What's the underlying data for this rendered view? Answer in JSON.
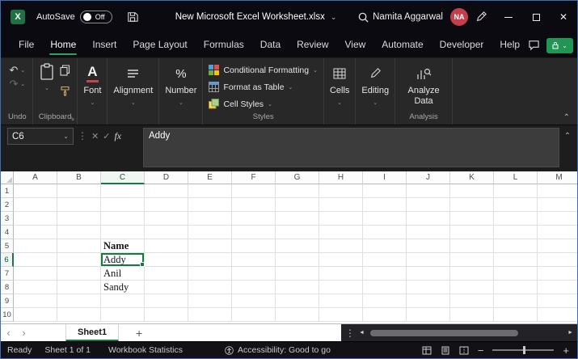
{
  "colors": {
    "accent_green": "#107C41",
    "menu_underline_green": "#2DA160",
    "avatar_red": "#C43E4B",
    "editing_button_green": "#1F9654",
    "window_border_blue": "#3E6DB5"
  },
  "titlebar": {
    "autosave_label": "AutoSave",
    "autosave_state": "Off",
    "doc_title": "New Microsoft Excel Worksheet.xlsx",
    "user_name": "Namita Aggarwal",
    "user_initials": "NA"
  },
  "menubar": {
    "items": [
      "File",
      "Home",
      "Insert",
      "Page Layout",
      "Formulas",
      "Data",
      "Review",
      "View",
      "Automate",
      "Developer",
      "Help"
    ],
    "active_item": "Home"
  },
  "ribbon": {
    "undo": {
      "group_label": "Undo"
    },
    "clipboard": {
      "group_label": "Clipboard"
    },
    "font": {
      "label": "Font"
    },
    "alignment": {
      "label": "Alignment"
    },
    "number": {
      "label": "Number"
    },
    "styles": {
      "group_label": "Styles",
      "buttons": [
        "Conditional Formatting",
        "Format as Table",
        "Cell Styles"
      ]
    },
    "cells": {
      "label": "Cells"
    },
    "editing": {
      "label": "Editing"
    },
    "analysis": {
      "group_label": "Analysis",
      "button_label": "Analyze Data"
    }
  },
  "formula_bar": {
    "name_box": "C6",
    "content": "Addy"
  },
  "grid": {
    "columns": [
      "A",
      "B",
      "C",
      "D",
      "E",
      "F",
      "G",
      "H",
      "I",
      "J",
      "K",
      "L",
      "M"
    ],
    "rows": [
      "1",
      "2",
      "3",
      "4",
      "5",
      "6",
      "7",
      "8",
      "9",
      "10"
    ],
    "cells": [
      {
        "col": "C",
        "row": "5",
        "value": "Name",
        "bold": true
      },
      {
        "col": "C",
        "row": "6",
        "value": "Addy",
        "selected": true
      },
      {
        "col": "C",
        "row": "7",
        "value": "Anil"
      },
      {
        "col": "C",
        "row": "8",
        "value": "Sandy"
      }
    ],
    "selection": {
      "col": "C",
      "row": "6",
      "ref": "C6"
    }
  },
  "sheet_bar": {
    "tabs": [
      {
        "label": "Sheet1",
        "active": true
      }
    ]
  },
  "status_bar": {
    "ready": "Ready",
    "sheet_count": "Sheet 1 of 1",
    "workbook_statistics": "Workbook Statistics",
    "accessibility": "Accessibility: Good to go"
  },
  "icons": {
    "undo": "↶",
    "redo": "↷",
    "chevron_down": "⌄",
    "chevron_up": "⌃",
    "cancel": "✕",
    "enter": "✓",
    "fx": "fx",
    "dots_vertical": "⋮",
    "nav_left": "‹",
    "nav_right": "›",
    "add_sheet": "+",
    "scroll_left": "◄",
    "scroll_right": "►",
    "zoom_out": "−",
    "zoom_in": "+",
    "dialog_launcher": "⇘",
    "close": "✕",
    "percent": "%",
    "font_a": "A"
  }
}
